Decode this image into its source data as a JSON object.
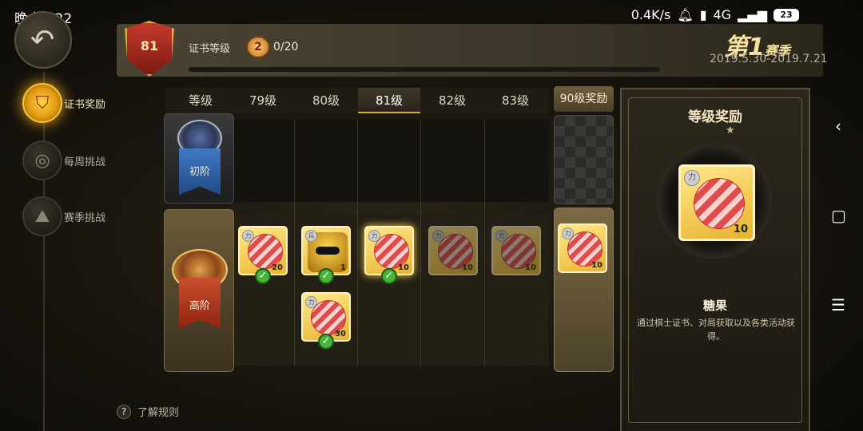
{
  "status_bar": {
    "time": "晚上8:22",
    "net_speed": "0.4K/s",
    "network": "4G",
    "battery": "23"
  },
  "nav": {
    "back_icon": "back-arrow-icon",
    "items": [
      {
        "label": "证书奖励",
        "icon": "shield-badge-icon",
        "active": true
      },
      {
        "label": "每周挑战",
        "icon": "target-icon",
        "active": false
      },
      {
        "label": "赛季挑战",
        "icon": "mountain-flag-icon",
        "active": false
      }
    ]
  },
  "header": {
    "level": "81",
    "cert_label": "证书等级",
    "badge": "2",
    "progress_text": "0/20",
    "progress_fraction": 0.0,
    "season_prefix": "第",
    "season_number": "1",
    "season_suffix": "赛季",
    "season_dates": "2019.5.30-2019.7.21"
  },
  "tabs": {
    "header_label": "等级",
    "levels": [
      "79级",
      "80级",
      "81级",
      "82级",
      "83级"
    ],
    "selected": "81级",
    "bonus_tab": "90级奖励"
  },
  "tiers": {
    "basic": "初阶",
    "advanced": "高阶"
  },
  "rewards": [
    {
      "level": "79级",
      "item": "candy",
      "qty": "20",
      "claimed": true
    },
    {
      "level": "80级",
      "item": "hero",
      "qty": "1",
      "claimed": true
    },
    {
      "level": "80级",
      "item": "candy",
      "qty": "30",
      "claimed": true
    },
    {
      "level": "81级",
      "item": "candy",
      "qty": "10",
      "claimed": true
    },
    {
      "level": "82级",
      "item": "candy",
      "qty": "10",
      "claimed": false
    },
    {
      "level": "83级",
      "item": "candy",
      "qty": "10",
      "claimed": false
    },
    {
      "level": "90级",
      "item": "candy",
      "qty": "10",
      "claimed": false
    }
  ],
  "detail": {
    "title": "等级奖励",
    "qty": "10",
    "name": "糖果",
    "description": "通过棋士证书、对局获取以及各类活动获得。"
  },
  "footer": {
    "rules_label": "了解规则"
  },
  "colors": {
    "accent_gold": "#e8a118",
    "check_green": "#47b43a",
    "card_gold": "#e9b531"
  }
}
